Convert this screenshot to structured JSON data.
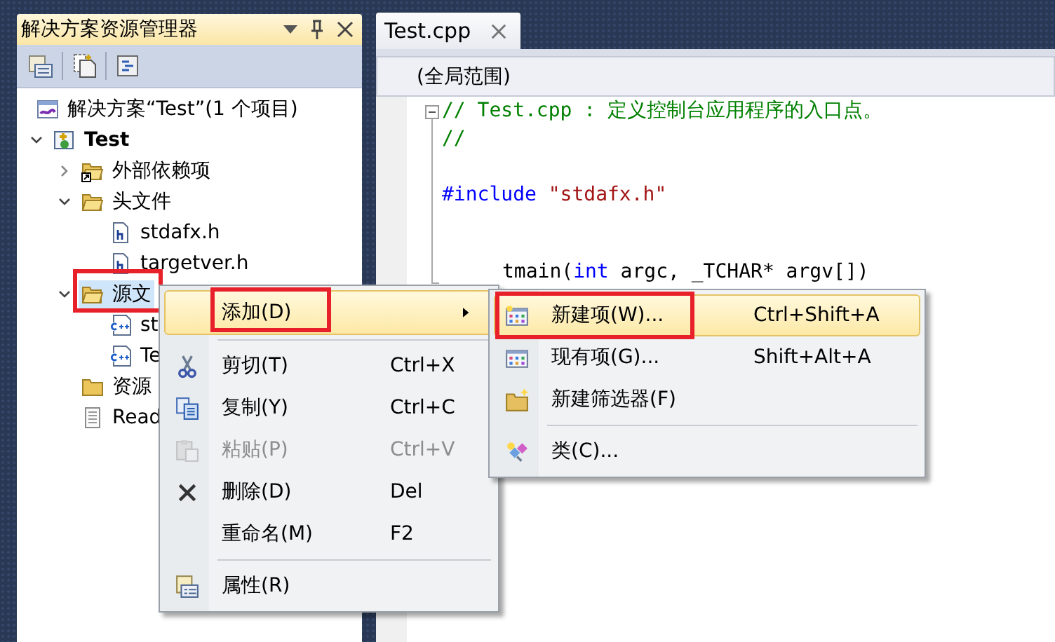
{
  "solution_explorer": {
    "title": "解决方案资源管理器",
    "tree": [
      {
        "label": "解决方案“Test”(1 个项目)",
        "kind": "solution",
        "selected": false,
        "children": [
          {
            "label": "Test",
            "kind": "project",
            "expanded": true,
            "selected": false,
            "children": [
              {
                "label": "外部依赖项",
                "kind": "ref_folder",
                "expanded": false,
                "selected": false
              },
              {
                "label": "头文件",
                "kind": "folder",
                "expanded": true,
                "selected": false,
                "children": [
                  {
                    "label": "stdafx.h",
                    "kind": "header",
                    "selected": false
                  },
                  {
                    "label": "targetver.h",
                    "kind": "header",
                    "selected": false
                  }
                ]
              },
              {
                "label": "源文",
                "kind": "folder",
                "expanded": true,
                "selected": true,
                "callout": true,
                "children": [
                  {
                    "label": "st",
                    "kind": "source",
                    "selected": false
                  },
                  {
                    "label": "Te",
                    "kind": "source",
                    "selected": false
                  }
                ]
              },
              {
                "label": "资源",
                "kind": "closed_folder",
                "selected": false
              },
              {
                "label": "Read",
                "kind": "text",
                "selected": false
              }
            ]
          }
        ]
      }
    ]
  },
  "editor": {
    "tabs": [
      {
        "label": "Test.cpp",
        "selected": true
      }
    ],
    "scope": "(全局范围)",
    "lines": [
      {
        "kind": "code",
        "segments": [
          {
            "kind": "comment",
            "text": "// Test.cpp : 定义控制台应用程序的入口点。"
          }
        ]
      },
      {
        "kind": "code",
        "segments": [
          {
            "kind": "comment",
            "text": "//"
          }
        ]
      },
      {
        "kind": "blank"
      },
      {
        "kind": "code",
        "segments": [
          {
            "kind": "preprocessor",
            "text": "#include "
          },
          {
            "kind": "string",
            "text": "\"stdafx.h\""
          }
        ]
      },
      {
        "kind": "blank"
      },
      {
        "kind": "blank"
      },
      {
        "kind": "covered",
        "segments": [
          {
            "kind": "plain",
            "text": "tmain("
          },
          {
            "kind": "keyword",
            "text": "int"
          },
          {
            "kind": "plain",
            "text": " argc, _TCHAR* argv[])"
          }
        ]
      }
    ]
  },
  "context_menu": {
    "items": [
      {
        "kind": "item",
        "label": "添加(D)",
        "submenu": true,
        "selected": true,
        "callout": true,
        "disabled": false
      },
      {
        "kind": "separator"
      },
      {
        "kind": "item",
        "label": "剪切(T)",
        "shortcut": "Ctrl+X",
        "selected": false,
        "disabled": false
      },
      {
        "kind": "item",
        "label": "复制(Y)",
        "shortcut": "Ctrl+C",
        "selected": false,
        "disabled": false
      },
      {
        "kind": "item",
        "label": "粘贴(P)",
        "shortcut": "Ctrl+V",
        "selected": false,
        "disabled": true
      },
      {
        "kind": "item",
        "label": "删除(D)",
        "shortcut": "Del",
        "selected": false,
        "disabled": false
      },
      {
        "kind": "item",
        "label": "重命名(M)",
        "shortcut": "F2",
        "selected": false,
        "disabled": false
      },
      {
        "kind": "separator"
      },
      {
        "kind": "item",
        "label": "属性(R)",
        "selected": false,
        "disabled": false
      }
    ]
  },
  "submenu": {
    "items": [
      {
        "kind": "item",
        "label": "新建项(W)...",
        "shortcut": "Ctrl+Shift+A",
        "selected": true,
        "callout": true,
        "disabled": false
      },
      {
        "kind": "item",
        "label": "现有项(G)...",
        "shortcut": "Shift+Alt+A",
        "selected": false,
        "disabled": false
      },
      {
        "kind": "item",
        "label": "新建筛选器(F)",
        "selected": false,
        "disabled": false
      },
      {
        "kind": "separator"
      },
      {
        "kind": "item",
        "label": "类(C)...",
        "selected": false,
        "disabled": false
      }
    ]
  }
}
